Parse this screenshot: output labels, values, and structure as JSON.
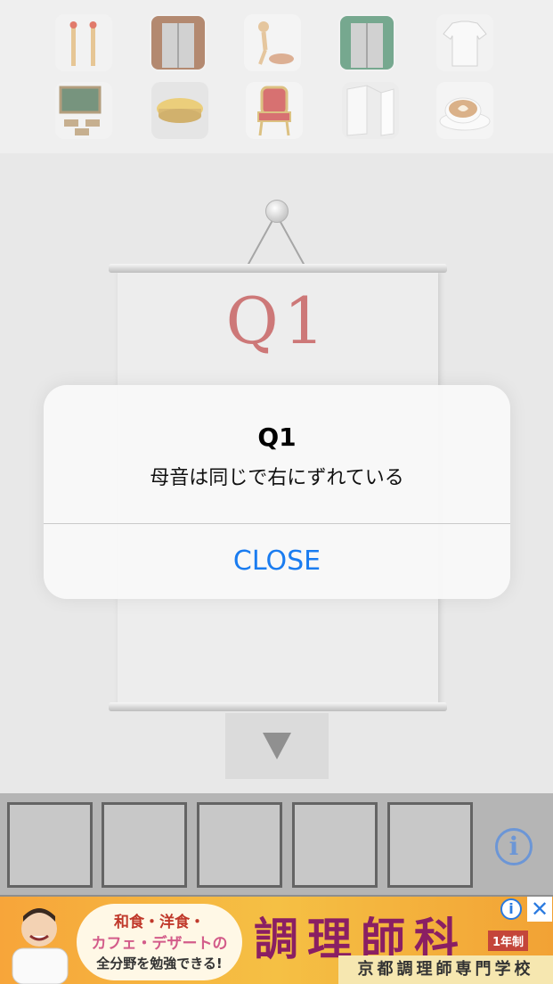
{
  "items_bar": {
    "items": [
      {
        "name": "matches"
      },
      {
        "name": "wooden-elevator"
      },
      {
        "name": "wooden-mannequin"
      },
      {
        "name": "green-elevator"
      },
      {
        "name": "t-shirt"
      },
      {
        "name": "classroom"
      },
      {
        "name": "round-table"
      },
      {
        "name": "red-chair"
      },
      {
        "name": "paper-shape"
      },
      {
        "name": "latte-cup"
      }
    ]
  },
  "scroll": {
    "title": "Q1"
  },
  "inventory": {
    "slot_count": 5,
    "info_symbol": "i"
  },
  "ad": {
    "bubble_line1": "和食・洋食・",
    "bubble_line2": "カフェ・デザートの",
    "bubble_line3": "全分野を勉強できる!",
    "headline": "調理師科",
    "badge": "1年制",
    "footer": "京都調理師専門学校",
    "info_symbol": "i",
    "close_symbol": "✕"
  },
  "alert": {
    "title": "Q1",
    "message": "母音は同じで右にずれている",
    "button_label": "CLOSE"
  },
  "colors": {
    "alert_button": "#1a7cf0",
    "scroll_title": "#b23030",
    "info_icon": "#1e5fc0"
  }
}
